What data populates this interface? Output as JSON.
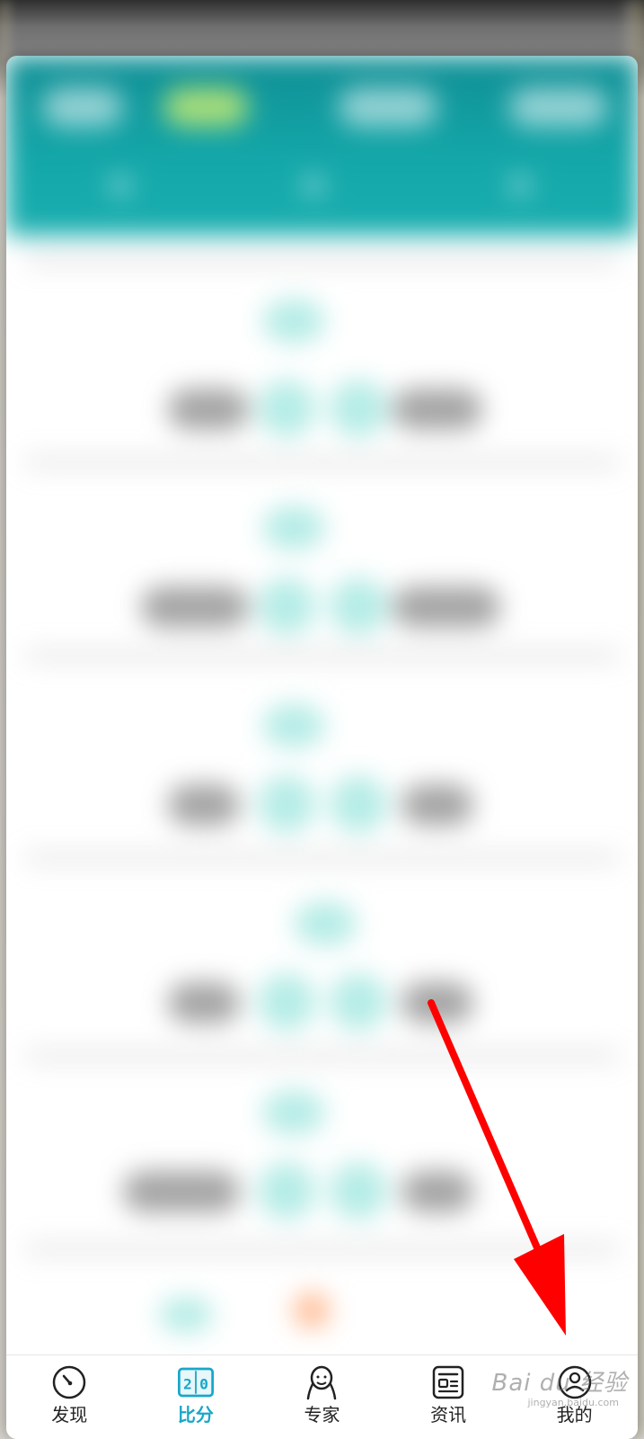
{
  "bottom_nav": {
    "items": [
      {
        "label": "发现",
        "icon": "discover-icon"
      },
      {
        "label": "比分",
        "icon": "scoreboard-icon",
        "icon_text": "2 0",
        "active": true
      },
      {
        "label": "专家",
        "icon": "expert-icon"
      },
      {
        "label": "资讯",
        "icon": "news-icon"
      },
      {
        "label": "我的",
        "icon": "profile-icon"
      }
    ]
  },
  "watermark": {
    "text": "Bai du 经验",
    "sub": "jingyan.baidu.com"
  },
  "colors": {
    "accent": "#19a7c8",
    "header_teal": "#14a8aa",
    "annotation": "#ff0000"
  }
}
